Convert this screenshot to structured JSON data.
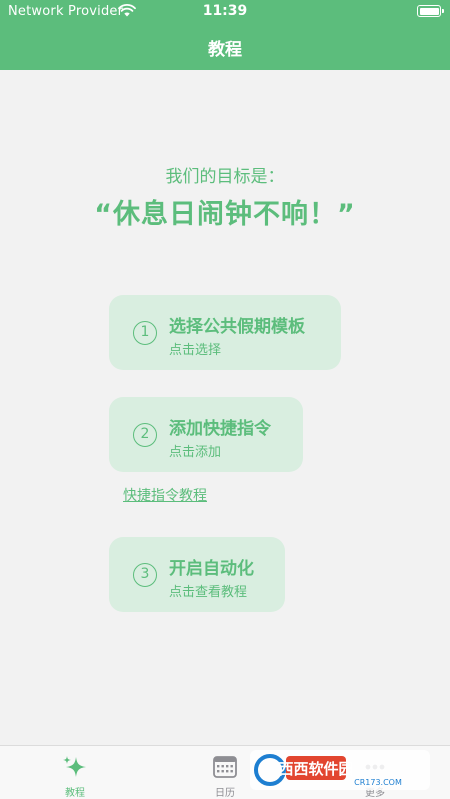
{
  "status_bar": {
    "carrier": "Network Provider",
    "time": "11:39"
  },
  "nav": {
    "title": "教程"
  },
  "goal": {
    "label": "我们的目标是：",
    "quote": "“休息日闹钟不响！”"
  },
  "steps": [
    {
      "number": "1",
      "title": "选择公共假期模板",
      "subtitle": "点击选择"
    },
    {
      "number": "2",
      "title": "添加快捷指令",
      "subtitle": "点击添加"
    },
    {
      "number": "3",
      "title": "开启自动化",
      "subtitle": "点击查看教程"
    }
  ],
  "shortcut_link": "快捷指令教程",
  "tabs": [
    {
      "label": "教程",
      "icon": "sparkle-icon",
      "active": true
    },
    {
      "label": "日历",
      "icon": "calendar-icon",
      "active": false
    },
    {
      "label": "更多",
      "icon": "more-icon",
      "active": false
    }
  ],
  "watermark": {
    "brand": "西西软件园",
    "domain": "CR173.COM"
  },
  "colors": {
    "accent": "#5cbd7c",
    "card": "#d9eee0",
    "background": "#f2f2f2"
  }
}
